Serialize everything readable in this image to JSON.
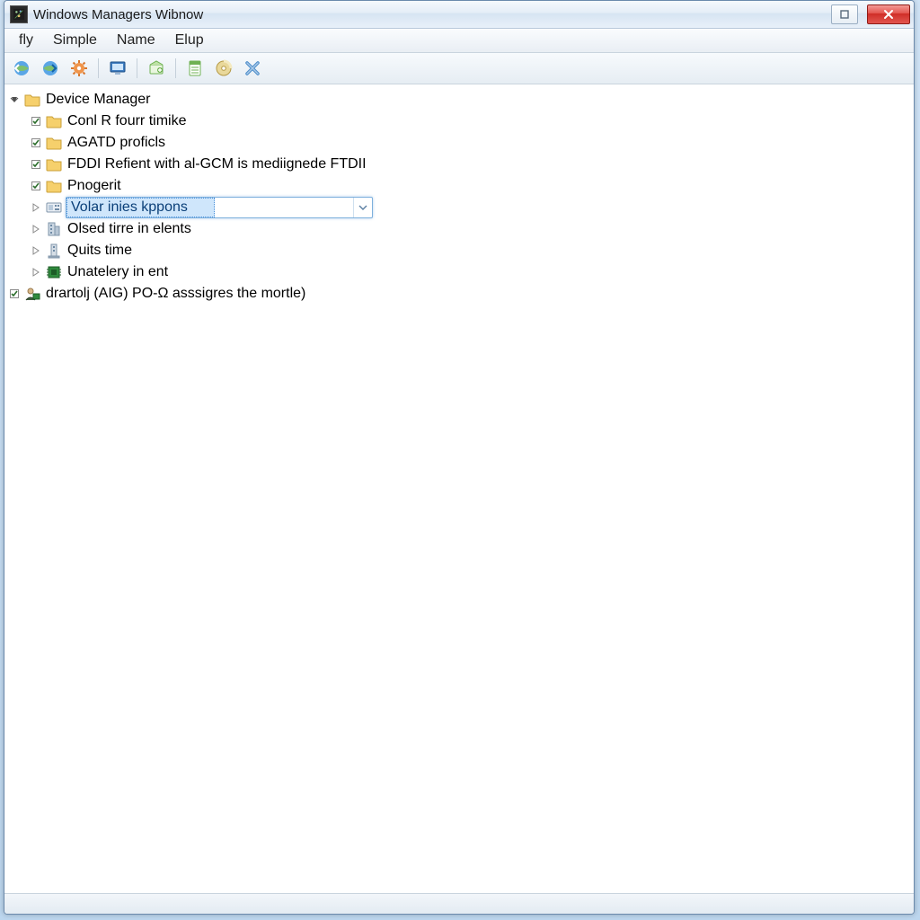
{
  "window": {
    "title": "Windows Managers Wibnow"
  },
  "menu": {
    "items": [
      "fly",
      "Simple",
      "Name",
      "Elup"
    ]
  },
  "toolbar": {
    "icons": [
      "globe-back-icon",
      "globe-forward-icon",
      "gear-orange-icon",
      "sep",
      "monitor-blue-icon",
      "sep",
      "box-green-icon",
      "sep",
      "sheet-green-icon",
      "disc-icon",
      "x-blue-icon"
    ]
  },
  "tree": {
    "root": {
      "label": "Device Manager",
      "expanded": true,
      "icon": "folder-icon",
      "children": [
        {
          "label": "Conl R fourr timike",
          "expander": "check",
          "icon": "folder-icon"
        },
        {
          "label": "AGATD proficls",
          "expander": "check",
          "icon": "folder-icon"
        },
        {
          "label": "FDDI Refient with al-GCM is mediignede FTDII",
          "expander": "check",
          "icon": "folder-icon"
        },
        {
          "label": "Pnogerit",
          "expander": "check",
          "icon": "folder-icon"
        },
        {
          "label": "Volar inies kppons",
          "expander": "arrow",
          "icon": "card-icon",
          "combo": true
        },
        {
          "label": "Olsed tirre in elents",
          "expander": "arrow",
          "icon": "building-icon"
        },
        {
          "label": "Quits time",
          "expander": "arrow",
          "icon": "tower-icon"
        },
        {
          "label": "Unatelery in ent",
          "expander": "arrow",
          "icon": "chip-icon"
        }
      ]
    },
    "sibling": {
      "label": "drartolj (AIG) PO-Ω asssigres the mortle)",
      "expander": "check",
      "icon": "user-chip-icon"
    }
  }
}
